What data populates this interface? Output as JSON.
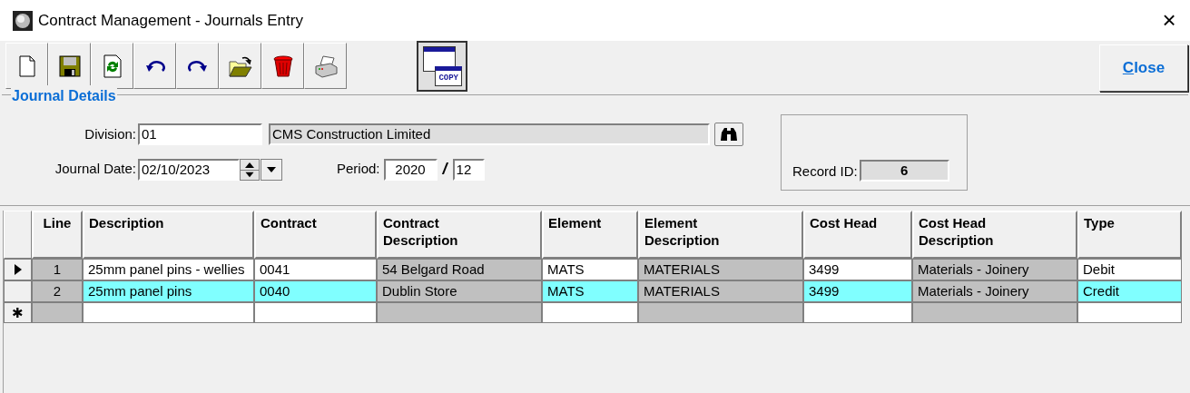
{
  "window": {
    "title": "Contract Management - Journals Entry",
    "close": "×"
  },
  "toolbar": [
    {
      "kind": "new"
    },
    {
      "kind": "save"
    },
    {
      "kind": "refresh"
    },
    {
      "kind": "undo"
    },
    {
      "kind": "redo"
    },
    {
      "kind": "open"
    },
    {
      "kind": "delete"
    },
    {
      "kind": "print"
    }
  ],
  "copy_button": {
    "label": "COPY"
  },
  "close_button": {
    "label": "Close"
  },
  "journal_details": {
    "title": "Journal Details",
    "division_label": "Division:",
    "division": "01",
    "division_name": "CMS Construction Limited",
    "date_label": "Journal Date:",
    "date": "02/10/2023",
    "period_label": "Period:",
    "period_year": "2020",
    "period_separator": "/",
    "period_month": "12",
    "record_label": "Record ID:",
    "record_id": "6"
  },
  "grid": {
    "columns": [
      {
        "label": "Line",
        "readonly": true
      },
      {
        "label": "Description",
        "readonly": false
      },
      {
        "label": "Contract",
        "readonly": false
      },
      {
        "label": "Contract Description",
        "readonly": true
      },
      {
        "label": "Element",
        "readonly": false
      },
      {
        "label": "Element Description",
        "readonly": true
      },
      {
        "label": "Cost Head",
        "readonly": false
      },
      {
        "label": "Cost Head Description",
        "readonly": true
      },
      {
        "label": "Type",
        "readonly": false
      }
    ],
    "rows": [
      {
        "current": true,
        "selected": false,
        "cells": [
          "1",
          "25mm panel pins - wellies",
          "0041",
          "54 Belgard Road",
          "MATS",
          "MATERIALS",
          "3499",
          "Materials - Joinery",
          "Debit"
        ]
      },
      {
        "current": false,
        "selected": true,
        "cells": [
          "2",
          "25mm panel pins",
          "0040",
          "Dublin Store",
          "MATS",
          "MATERIALS",
          "3499",
          "Materials - Joinery",
          "Credit"
        ]
      }
    ],
    "new_row_marker": "✱"
  }
}
